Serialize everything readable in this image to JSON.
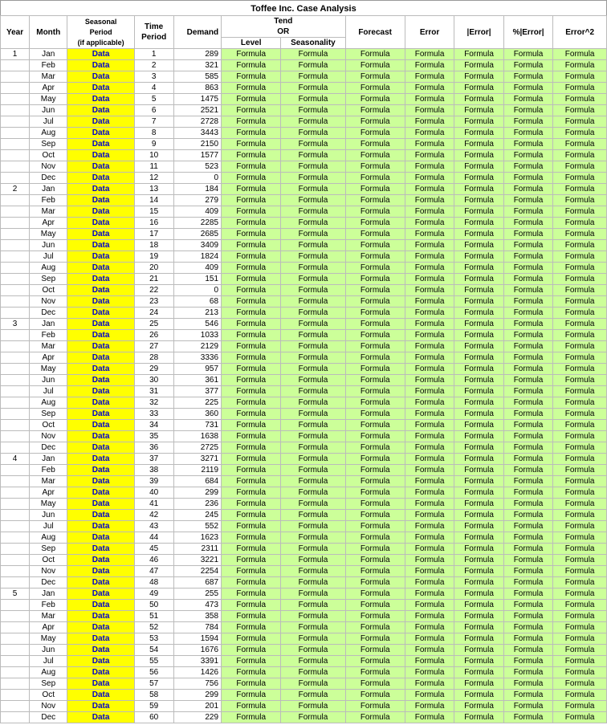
{
  "title": "Toffee Inc. Case Analysis",
  "headers": {
    "row1": [
      "Year",
      "Month",
      "Seasonal\nPeriod\n(if applicable)",
      "Time\nPeriod",
      "Demand",
      "Tend\nOR\nLevel",
      "Seasonality",
      "Forecast",
      "Error",
      "|Error|",
      "%|Error|",
      "Error^2"
    ],
    "h_year": "Year",
    "h_month": "Month",
    "h_seasonal": "Seasonal Period (if applicable)",
    "h_time": "Time Period",
    "h_demand": "Demand",
    "h_tend": "Tend OR",
    "h_level": "Level",
    "h_seasonality": "Seasonality",
    "h_forecast": "Forecast",
    "h_error": "Error",
    "h_abserror": "|Error|",
    "h_pcterror": "%|Error|",
    "h_error2": "Error^2"
  },
  "rows": [
    {
      "year": "1",
      "month": "Jan",
      "seasonal": "Data",
      "time": "1",
      "demand": "289",
      "level": "Formula",
      "seasonality": "Formula",
      "forecast": "Formula",
      "error": "Formula",
      "abserror": "Formula",
      "pcterror": "Formula",
      "error2": "Formula"
    },
    {
      "year": "",
      "month": "Feb",
      "seasonal": "Data",
      "time": "2",
      "demand": "321",
      "level": "Formula",
      "seasonality": "Formula",
      "forecast": "Formula",
      "error": "Formula",
      "abserror": "Formula",
      "pcterror": "Formula",
      "error2": "Formula"
    },
    {
      "year": "",
      "month": "Mar",
      "seasonal": "Data",
      "time": "3",
      "demand": "585",
      "level": "Formula",
      "seasonality": "Formula",
      "forecast": "Formula",
      "error": "Formula",
      "abserror": "Formula",
      "pcterror": "Formula",
      "error2": "Formula"
    },
    {
      "year": "",
      "month": "Apr",
      "seasonal": "Data",
      "time": "4",
      "demand": "863",
      "level": "Formula",
      "seasonality": "Formula",
      "forecast": "Formula",
      "error": "Formula",
      "abserror": "Formula",
      "pcterror": "Formula",
      "error2": "Formula"
    },
    {
      "year": "",
      "month": "May",
      "seasonal": "Data",
      "time": "5",
      "demand": "1475",
      "level": "Formula",
      "seasonality": "Formula",
      "forecast": "Formula",
      "error": "Formula",
      "abserror": "Formula",
      "pcterror": "Formula",
      "error2": "Formula"
    },
    {
      "year": "",
      "month": "Jun",
      "seasonal": "Data",
      "time": "6",
      "demand": "2521",
      "level": "Formula",
      "seasonality": "Formula",
      "forecast": "Formula",
      "error": "Formula",
      "abserror": "Formula",
      "pcterror": "Formula",
      "error2": "Formula"
    },
    {
      "year": "",
      "month": "Jul",
      "seasonal": "Data",
      "time": "7",
      "demand": "2728",
      "level": "Formula",
      "seasonality": "Formula",
      "forecast": "Formula",
      "error": "Formula",
      "abserror": "Formula",
      "pcterror": "Formula",
      "error2": "Formula"
    },
    {
      "year": "",
      "month": "Aug",
      "seasonal": "Data",
      "time": "8",
      "demand": "3443",
      "level": "Formula",
      "seasonality": "Formula",
      "forecast": "Formula",
      "error": "Formula",
      "abserror": "Formula",
      "pcterror": "Formula",
      "error2": "Formula"
    },
    {
      "year": "",
      "month": "Sep",
      "seasonal": "Data",
      "time": "9",
      "demand": "2150",
      "level": "Formula",
      "seasonality": "Formula",
      "forecast": "Formula",
      "error": "Formula",
      "abserror": "Formula",
      "pcterror": "Formula",
      "error2": "Formula"
    },
    {
      "year": "",
      "month": "Oct",
      "seasonal": "Data",
      "time": "10",
      "demand": "1577",
      "level": "Formula",
      "seasonality": "Formula",
      "forecast": "Formula",
      "error": "Formula",
      "abserror": "Formula",
      "pcterror": "Formula",
      "error2": "Formula"
    },
    {
      "year": "",
      "month": "Nov",
      "seasonal": "Data",
      "time": "11",
      "demand": "523",
      "level": "Formula",
      "seasonality": "Formula",
      "forecast": "Formula",
      "error": "Formula",
      "abserror": "Formula",
      "pcterror": "Formula",
      "error2": "Formula"
    },
    {
      "year": "",
      "month": "Dec",
      "seasonal": "Data",
      "time": "12",
      "demand": "0",
      "level": "Formula",
      "seasonality": "Formula",
      "forecast": "Formula",
      "error": "Formula",
      "abserror": "Formula",
      "pcterror": "Formula",
      "error2": "Formula"
    },
    {
      "year": "2",
      "month": "Jan",
      "seasonal": "Data",
      "time": "13",
      "demand": "184",
      "level": "Formula",
      "seasonality": "Formula",
      "forecast": "Formula",
      "error": "Formula",
      "abserror": "Formula",
      "pcterror": "Formula",
      "error2": "Formula"
    },
    {
      "year": "",
      "month": "Feb",
      "seasonal": "Data",
      "time": "14",
      "demand": "279",
      "level": "Formula",
      "seasonality": "Formula",
      "forecast": "Formula",
      "error": "Formula",
      "abserror": "Formula",
      "pcterror": "Formula",
      "error2": "Formula"
    },
    {
      "year": "",
      "month": "Mar",
      "seasonal": "Data",
      "time": "15",
      "demand": "409",
      "level": "Formula",
      "seasonality": "Formula",
      "forecast": "Formula",
      "error": "Formula",
      "abserror": "Formula",
      "pcterror": "Formula",
      "error2": "Formula"
    },
    {
      "year": "",
      "month": "Apr",
      "seasonal": "Data",
      "time": "16",
      "demand": "2285",
      "level": "Formula",
      "seasonality": "Formula",
      "forecast": "Formula",
      "error": "Formula",
      "abserror": "Formula",
      "pcterror": "Formula",
      "error2": "Formula"
    },
    {
      "year": "",
      "month": "May",
      "seasonal": "Data",
      "time": "17",
      "demand": "2685",
      "level": "Formula",
      "seasonality": "Formula",
      "forecast": "Formula",
      "error": "Formula",
      "abserror": "Formula",
      "pcterror": "Formula",
      "error2": "Formula"
    },
    {
      "year": "",
      "month": "Jun",
      "seasonal": "Data",
      "time": "18",
      "demand": "3409",
      "level": "Formula",
      "seasonality": "Formula",
      "forecast": "Formula",
      "error": "Formula",
      "abserror": "Formula",
      "pcterror": "Formula",
      "error2": "Formula"
    },
    {
      "year": "",
      "month": "Jul",
      "seasonal": "Data",
      "time": "19",
      "demand": "1824",
      "level": "Formula",
      "seasonality": "Formula",
      "forecast": "Formula",
      "error": "Formula",
      "abserror": "Formula",
      "pcterror": "Formula",
      "error2": "Formula"
    },
    {
      "year": "",
      "month": "Aug",
      "seasonal": "Data",
      "time": "20",
      "demand": "409",
      "level": "Formula",
      "seasonality": "Formula",
      "forecast": "Formula",
      "error": "Formula",
      "abserror": "Formula",
      "pcterror": "Formula",
      "error2": "Formula"
    },
    {
      "year": "",
      "month": "Sep",
      "seasonal": "Data",
      "time": "21",
      "demand": "151",
      "level": "Formula",
      "seasonality": "Formula",
      "forecast": "Formula",
      "error": "Formula",
      "abserror": "Formula",
      "pcterror": "Formula",
      "error2": "Formula"
    },
    {
      "year": "",
      "month": "Oct",
      "seasonal": "Data",
      "time": "22",
      "demand": "0",
      "level": "Formula",
      "seasonality": "Formula",
      "forecast": "Formula",
      "error": "Formula",
      "abserror": "Formula",
      "pcterror": "Formula",
      "error2": "Formula"
    },
    {
      "year": "",
      "month": "Nov",
      "seasonal": "Data",
      "time": "23",
      "demand": "68",
      "level": "Formula",
      "seasonality": "Formula",
      "forecast": "Formula",
      "error": "Formula",
      "abserror": "Formula",
      "pcterror": "Formula",
      "error2": "Formula"
    },
    {
      "year": "",
      "month": "Dec",
      "seasonal": "Data",
      "time": "24",
      "demand": "213",
      "level": "Formula",
      "seasonality": "Formula",
      "forecast": "Formula",
      "error": "Formula",
      "abserror": "Formula",
      "pcterror": "Formula",
      "error2": "Formula"
    },
    {
      "year": "3",
      "month": "Jan",
      "seasonal": "Data",
      "time": "25",
      "demand": "546",
      "level": "Formula",
      "seasonality": "Formula",
      "forecast": "Formula",
      "error": "Formula",
      "abserror": "Formula",
      "pcterror": "Formula",
      "error2": "Formula"
    },
    {
      "year": "",
      "month": "Feb",
      "seasonal": "Data",
      "time": "26",
      "demand": "1033",
      "level": "Formula",
      "seasonality": "Formula",
      "forecast": "Formula",
      "error": "Formula",
      "abserror": "Formula",
      "pcterror": "Formula",
      "error2": "Formula"
    },
    {
      "year": "",
      "month": "Mar",
      "seasonal": "Data",
      "time": "27",
      "demand": "2129",
      "level": "Formula",
      "seasonality": "Formula",
      "forecast": "Formula",
      "error": "Formula",
      "abserror": "Formula",
      "pcterror": "Formula",
      "error2": "Formula"
    },
    {
      "year": "",
      "month": "Apr",
      "seasonal": "Data",
      "time": "28",
      "demand": "3336",
      "level": "Formula",
      "seasonality": "Formula",
      "forecast": "Formula",
      "error": "Formula",
      "abserror": "Formula",
      "pcterror": "Formula",
      "error2": "Formula"
    },
    {
      "year": "",
      "month": "May",
      "seasonal": "Data",
      "time": "29",
      "demand": "957",
      "level": "Formula",
      "seasonality": "Formula",
      "forecast": "Formula",
      "error": "Formula",
      "abserror": "Formula",
      "pcterror": "Formula",
      "error2": "Formula"
    },
    {
      "year": "",
      "month": "Jun",
      "seasonal": "Data",
      "time": "30",
      "demand": "361",
      "level": "Formula",
      "seasonality": "Formula",
      "forecast": "Formula",
      "error": "Formula",
      "abserror": "Formula",
      "pcterror": "Formula",
      "error2": "Formula"
    },
    {
      "year": "",
      "month": "Jul",
      "seasonal": "Data",
      "time": "31",
      "demand": "377",
      "level": "Formula",
      "seasonality": "Formula",
      "forecast": "Formula",
      "error": "Formula",
      "abserror": "Formula",
      "pcterror": "Formula",
      "error2": "Formula"
    },
    {
      "year": "",
      "month": "Aug",
      "seasonal": "Data",
      "time": "32",
      "demand": "225",
      "level": "Formula",
      "seasonality": "Formula",
      "forecast": "Formula",
      "error": "Formula",
      "abserror": "Formula",
      "pcterror": "Formula",
      "error2": "Formula"
    },
    {
      "year": "",
      "month": "Sep",
      "seasonal": "Data",
      "time": "33",
      "demand": "360",
      "level": "Formula",
      "seasonality": "Formula",
      "forecast": "Formula",
      "error": "Formula",
      "abserror": "Formula",
      "pcterror": "Formula",
      "error2": "Formula"
    },
    {
      "year": "",
      "month": "Oct",
      "seasonal": "Data",
      "time": "34",
      "demand": "731",
      "level": "Formula",
      "seasonality": "Formula",
      "forecast": "Formula",
      "error": "Formula",
      "abserror": "Formula",
      "pcterror": "Formula",
      "error2": "Formula"
    },
    {
      "year": "",
      "month": "Nov",
      "seasonal": "Data",
      "time": "35",
      "demand": "1638",
      "level": "Formula",
      "seasonality": "Formula",
      "forecast": "Formula",
      "error": "Formula",
      "abserror": "Formula",
      "pcterror": "Formula",
      "error2": "Formula"
    },
    {
      "year": "",
      "month": "Dec",
      "seasonal": "Data",
      "time": "36",
      "demand": "2725",
      "level": "Formula",
      "seasonality": "Formula",
      "forecast": "Formula",
      "error": "Formula",
      "abserror": "Formula",
      "pcterror": "Formula",
      "error2": "Formula"
    },
    {
      "year": "4",
      "month": "Jan",
      "seasonal": "Data",
      "time": "37",
      "demand": "3271",
      "level": "Formula",
      "seasonality": "Formula",
      "forecast": "Formula",
      "error": "Formula",
      "abserror": "Formula",
      "pcterror": "Formula",
      "error2": "Formula"
    },
    {
      "year": "",
      "month": "Feb",
      "seasonal": "Data",
      "time": "38",
      "demand": "2119",
      "level": "Formula",
      "seasonality": "Formula",
      "forecast": "Formula",
      "error": "Formula",
      "abserror": "Formula",
      "pcterror": "Formula",
      "error2": "Formula"
    },
    {
      "year": "",
      "month": "Mar",
      "seasonal": "Data",
      "time": "39",
      "demand": "684",
      "level": "Formula",
      "seasonality": "Formula",
      "forecast": "Formula",
      "error": "Formula",
      "abserror": "Formula",
      "pcterror": "Formula",
      "error2": "Formula"
    },
    {
      "year": "",
      "month": "Apr",
      "seasonal": "Data",
      "time": "40",
      "demand": "299",
      "level": "Formula",
      "seasonality": "Formula",
      "forecast": "Formula",
      "error": "Formula",
      "abserror": "Formula",
      "pcterror": "Formula",
      "error2": "Formula"
    },
    {
      "year": "",
      "month": "May",
      "seasonal": "Data",
      "time": "41",
      "demand": "236",
      "level": "Formula",
      "seasonality": "Formula",
      "forecast": "Formula",
      "error": "Formula",
      "abserror": "Formula",
      "pcterror": "Formula",
      "error2": "Formula"
    },
    {
      "year": "",
      "month": "Jun",
      "seasonal": "Data",
      "time": "42",
      "demand": "245",
      "level": "Formula",
      "seasonality": "Formula",
      "forecast": "Formula",
      "error": "Formula",
      "abserror": "Formula",
      "pcterror": "Formula",
      "error2": "Formula"
    },
    {
      "year": "",
      "month": "Jul",
      "seasonal": "Data",
      "time": "43",
      "demand": "552",
      "level": "Formula",
      "seasonality": "Formula",
      "forecast": "Formula",
      "error": "Formula",
      "abserror": "Formula",
      "pcterror": "Formula",
      "error2": "Formula"
    },
    {
      "year": "",
      "month": "Aug",
      "seasonal": "Data",
      "time": "44",
      "demand": "1623",
      "level": "Formula",
      "seasonality": "Formula",
      "forecast": "Formula",
      "error": "Formula",
      "abserror": "Formula",
      "pcterror": "Formula",
      "error2": "Formula"
    },
    {
      "year": "",
      "month": "Sep",
      "seasonal": "Data",
      "time": "45",
      "demand": "2311",
      "level": "Formula",
      "seasonality": "Formula",
      "forecast": "Formula",
      "error": "Formula",
      "abserror": "Formula",
      "pcterror": "Formula",
      "error2": "Formula"
    },
    {
      "year": "",
      "month": "Oct",
      "seasonal": "Data",
      "time": "46",
      "demand": "3221",
      "level": "Formula",
      "seasonality": "Formula",
      "forecast": "Formula",
      "error": "Formula",
      "abserror": "Formula",
      "pcterror": "Formula",
      "error2": "Formula"
    },
    {
      "year": "",
      "month": "Nov",
      "seasonal": "Data",
      "time": "47",
      "demand": "2254",
      "level": "Formula",
      "seasonality": "Formula",
      "forecast": "Formula",
      "error": "Formula",
      "abserror": "Formula",
      "pcterror": "Formula",
      "error2": "Formula"
    },
    {
      "year": "",
      "month": "Dec",
      "seasonal": "Data",
      "time": "48",
      "demand": "687",
      "level": "Formula",
      "seasonality": "Formula",
      "forecast": "Formula",
      "error": "Formula",
      "abserror": "Formula",
      "pcterror": "Formula",
      "error2": "Formula"
    },
    {
      "year": "5",
      "month": "Jan",
      "seasonal": "Data",
      "time": "49",
      "demand": "255",
      "level": "Formula",
      "seasonality": "Formula",
      "forecast": "Formula",
      "error": "Formula",
      "abserror": "Formula",
      "pcterror": "Formula",
      "error2": "Formula"
    },
    {
      "year": "",
      "month": "Feb",
      "seasonal": "Data",
      "time": "50",
      "demand": "473",
      "level": "Formula",
      "seasonality": "Formula",
      "forecast": "Formula",
      "error": "Formula",
      "abserror": "Formula",
      "pcterror": "Formula",
      "error2": "Formula"
    },
    {
      "year": "",
      "month": "Mar",
      "seasonal": "Data",
      "time": "51",
      "demand": "358",
      "level": "Formula",
      "seasonality": "Formula",
      "forecast": "Formula",
      "error": "Formula",
      "abserror": "Formula",
      "pcterror": "Formula",
      "error2": "Formula"
    },
    {
      "year": "",
      "month": "Apr",
      "seasonal": "Data",
      "time": "52",
      "demand": "784",
      "level": "Formula",
      "seasonality": "Formula",
      "forecast": "Formula",
      "error": "Formula",
      "abserror": "Formula",
      "pcterror": "Formula",
      "error2": "Formula"
    },
    {
      "year": "",
      "month": "May",
      "seasonal": "Data",
      "time": "53",
      "demand": "1594",
      "level": "Formula",
      "seasonality": "Formula",
      "forecast": "Formula",
      "error": "Formula",
      "abserror": "Formula",
      "pcterror": "Formula",
      "error2": "Formula"
    },
    {
      "year": "",
      "month": "Jun",
      "seasonal": "Data",
      "time": "54",
      "demand": "1676",
      "level": "Formula",
      "seasonality": "Formula",
      "forecast": "Formula",
      "error": "Formula",
      "abserror": "Formula",
      "pcterror": "Formula",
      "error2": "Formula"
    },
    {
      "year": "",
      "month": "Jul",
      "seasonal": "Data",
      "time": "55",
      "demand": "3391",
      "level": "Formula",
      "seasonality": "Formula",
      "forecast": "Formula",
      "error": "Formula",
      "abserror": "Formula",
      "pcterror": "Formula",
      "error2": "Formula"
    },
    {
      "year": "",
      "month": "Aug",
      "seasonal": "Data",
      "time": "56",
      "demand": "1426",
      "level": "Formula",
      "seasonality": "Formula",
      "forecast": "Formula",
      "error": "Formula",
      "abserror": "Formula",
      "pcterror": "Formula",
      "error2": "Formula"
    },
    {
      "year": "",
      "month": "Sep",
      "seasonal": "Data",
      "time": "57",
      "demand": "756",
      "level": "Formula",
      "seasonality": "Formula",
      "forecast": "Formula",
      "error": "Formula",
      "abserror": "Formula",
      "pcterror": "Formula",
      "error2": "Formula"
    },
    {
      "year": "",
      "month": "Oct",
      "seasonal": "Data",
      "time": "58",
      "demand": "299",
      "level": "Formula",
      "seasonality": "Formula",
      "forecast": "Formula",
      "error": "Formula",
      "abserror": "Formula",
      "pcterror": "Formula",
      "error2": "Formula"
    },
    {
      "year": "",
      "month": "Nov",
      "seasonal": "Data",
      "time": "59",
      "demand": "201",
      "level": "Formula",
      "seasonality": "Formula",
      "forecast": "Formula",
      "error": "Formula",
      "abserror": "Formula",
      "pcterror": "Formula",
      "error2": "Formula"
    },
    {
      "year": "",
      "month": "Dec",
      "seasonal": "Data",
      "time": "60",
      "demand": "229",
      "level": "Formula",
      "seasonality": "Formula",
      "forecast": "Formula",
      "error": "Formula",
      "abserror": "Formula",
      "pcterror": "Formula",
      "error2": "Formula"
    }
  ]
}
